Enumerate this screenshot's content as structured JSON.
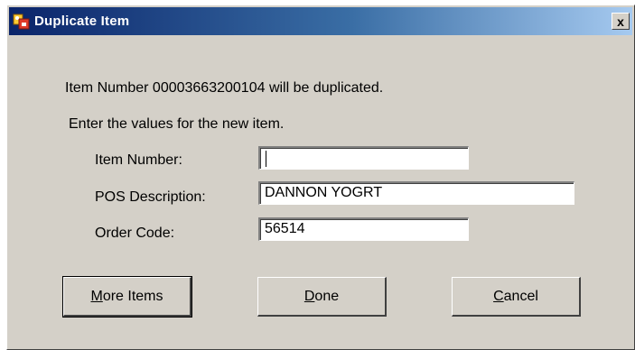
{
  "window": {
    "title": "Duplicate Item",
    "close_glyph": "x"
  },
  "messages": {
    "line1": "Item Number 00003663200104 will be duplicated.",
    "line2": "Enter the values for the new item."
  },
  "fields": {
    "item_number": {
      "label": "Item Number:",
      "value": ""
    },
    "pos_description": {
      "label": "POS Description:",
      "value": "DANNON YOGRT"
    },
    "order_code": {
      "label": "Order Code:",
      "value": "56514"
    }
  },
  "buttons": {
    "more_items": {
      "accel": "M",
      "rest": "ore Items"
    },
    "done": {
      "accel": "D",
      "rest": "one"
    },
    "cancel": {
      "accel": "C",
      "rest": "ancel"
    }
  },
  "colors": {
    "dialog_bg": "#d4d0c8",
    "titlebar_start": "#0a246a",
    "titlebar_end": "#a6caf0"
  }
}
